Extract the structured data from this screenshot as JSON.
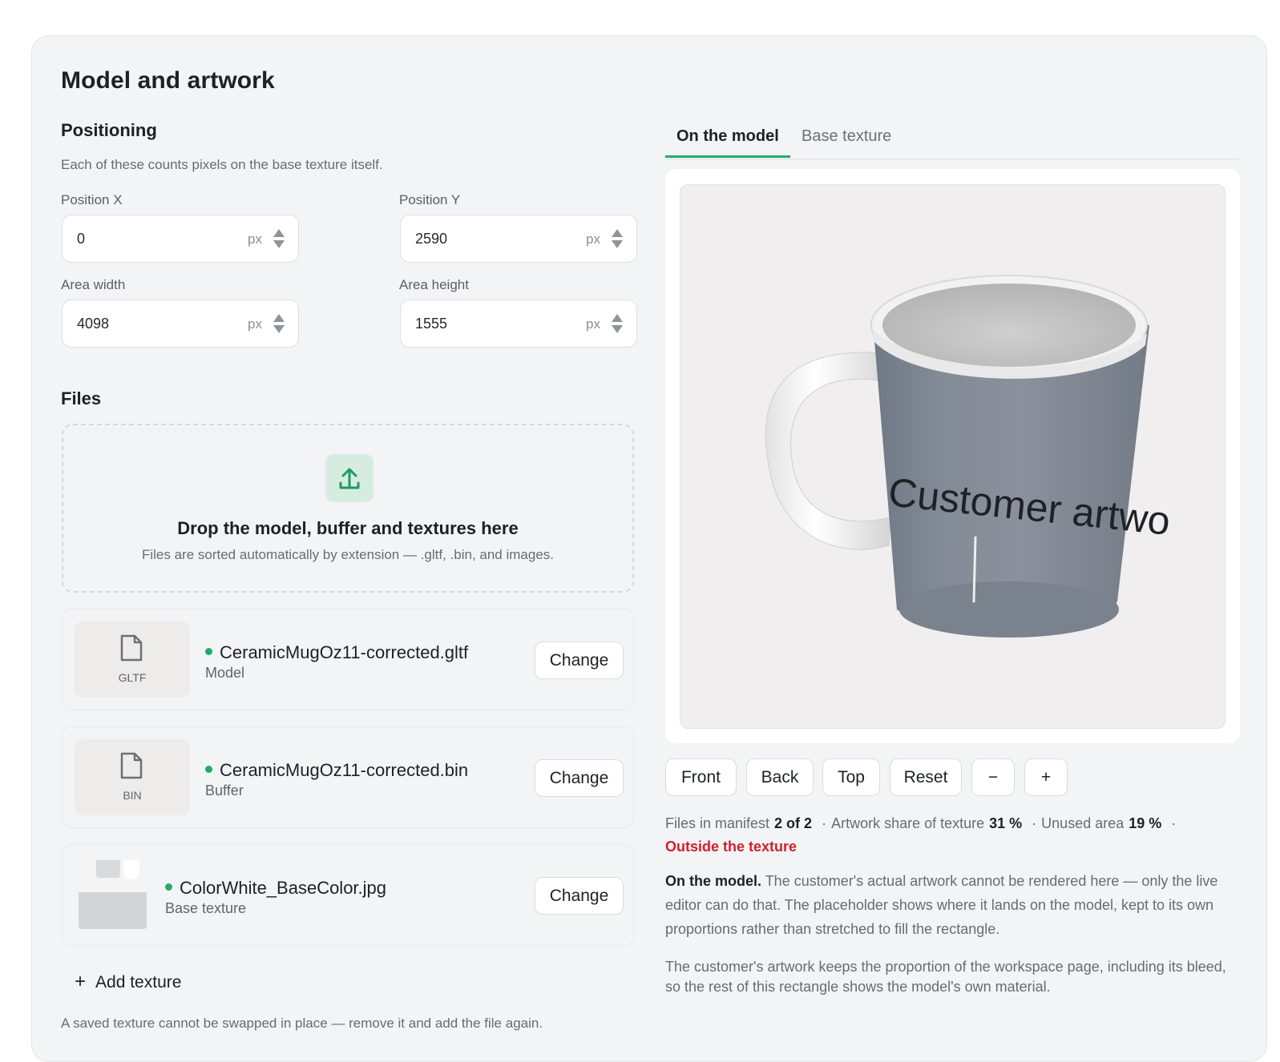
{
  "page": {
    "title": "Model and artwork"
  },
  "positioning": {
    "heading": "Positioning",
    "description": "Each of these counts pixels on the base texture itself.",
    "fields": {
      "position_x": {
        "label": "Position X",
        "value": "0",
        "unit": "px"
      },
      "position_y": {
        "label": "Position Y",
        "value": "2590",
        "unit": "px"
      },
      "area_width": {
        "label": "Area width",
        "value": "4098",
        "unit": "px"
      },
      "area_height": {
        "label": "Area height",
        "value": "1555",
        "unit": "px"
      }
    }
  },
  "files": {
    "heading": "Files",
    "dropzone": {
      "title": "Drop the model, buffer and textures here",
      "subtitle": "Files are sorted automatically by extension — .gltf, .bin, and images.",
      "icon": "upload-icon"
    },
    "items": [
      {
        "name": "CeramicMugOz11-corrected.gltf",
        "role": "Model",
        "type": "GLTF",
        "button": "Change",
        "status_color": "#1fae6a"
      },
      {
        "name": "CeramicMugOz11-corrected.bin",
        "role": "Buffer",
        "type": "BIN",
        "button": "Change",
        "status_color": "#1fae6a"
      },
      {
        "name": "ColorWhite_BaseColor.jpg",
        "role": "Base texture",
        "type": "",
        "button": "Change",
        "status_color": "#1fae6a"
      }
    ],
    "add_label": "Add texture",
    "note": "A saved texture cannot be swapped in place — remove it and add the file again."
  },
  "preview": {
    "tabs": [
      {
        "label": "On the model",
        "active": true
      },
      {
        "label": "Base texture",
        "active": false
      }
    ],
    "mug_text": "Customer artwo",
    "controls": {
      "front": "Front",
      "back": "Back",
      "top": "Top",
      "reset": "Reset",
      "zoom_out": "−",
      "zoom_in": "+"
    },
    "stats": {
      "files_label": "Files in manifest",
      "files_value": "2 of 2",
      "share_label": "Artwork share of texture",
      "share_value": "31 %",
      "unused_label": "Unused area",
      "unused_value": "19 %",
      "separator": "·",
      "warning": "Outside the texture"
    },
    "explanation": {
      "lead": "On the model.",
      "body": " The customer's actual artwork cannot be rendered here — only the live editor can do that. The placeholder shows where it lands on the model, kept to its own proportions rather than stretched to fill the rectangle.",
      "second": "The customer's artwork keeps the proportion of the workspace page, including its bleed, so the rest of this rectangle shows the model's own material."
    }
  },
  "colors": {
    "accent": "#1fae6a",
    "warning": "#d0202e",
    "card_bg": "#f3f4f6"
  }
}
